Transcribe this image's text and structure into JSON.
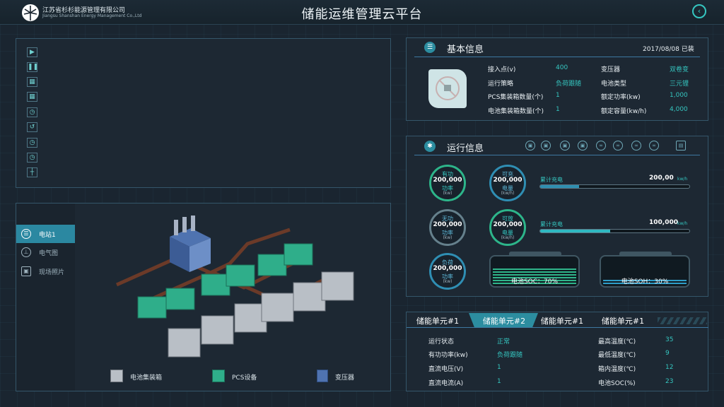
{
  "header": {
    "company_cn": "江苏省杉杉能源管理有限公司",
    "company_en": "Jiangsu Shanshan Energy Management Co.,Ltd",
    "title": "储能运维管理云平台",
    "back_icon": "back-arrow-icon"
  },
  "video_controls": [
    "play-icon",
    "pause-icon",
    "grid-4-icon",
    "grid-9-icon",
    "timer-icon",
    "history-icon",
    "clock-icon",
    "schedule-icon",
    "layout-icon"
  ],
  "station": {
    "sidebar": [
      {
        "label": "电站1",
        "icon": "station-icon",
        "active": true
      },
      {
        "label": "电气图",
        "icon": "circuit-icon",
        "active": false
      },
      {
        "label": "现场照片",
        "icon": "photo-icon",
        "active": false
      }
    ],
    "legend": [
      {
        "label": "电池集装箱",
        "icon": "battery-container-icon"
      },
      {
        "label": "PCS设备",
        "icon": "pcs-icon"
      },
      {
        "label": "变压器",
        "icon": "transformer-icon"
      }
    ]
  },
  "basic": {
    "title": "基本信息",
    "date": "2017/08/08 已装",
    "plug_icon": "plug-icon",
    "rows": [
      {
        "l1": "接入点(v)",
        "v1": "400",
        "l2": "变压器",
        "v2": "双卷变"
      },
      {
        "l1": "运行策略",
        "v1": "负荷跟随",
        "l2": "电池类型",
        "v2": "三元锂"
      },
      {
        "l1": "PCS集装箱数量(个)",
        "v1": "1",
        "l2": "额定功率(kw)",
        "v2": "1,000"
      },
      {
        "l1": "电池集装箱数量(个)",
        "v1": "1",
        "l2": "额定容量(kw/h)",
        "v2": "4,000"
      }
    ]
  },
  "runinfo": {
    "title": "运行信息",
    "tools": [
      "monitor-icon",
      "display-icon",
      "device-icon",
      "module-icon",
      "link-icon",
      "chain-icon",
      "connect-icon",
      "network-icon",
      "clipboard-icon"
    ],
    "gauges": [
      {
        "name": "有功",
        "value": "200,000",
        "sub": "功率",
        "unit": "(kw)",
        "style": "green"
      },
      {
        "name": "可充",
        "value": "200,000",
        "sub": "电量",
        "unit": "(kw/h)",
        "style": "blue"
      },
      {
        "name": "无功",
        "value": "200,000",
        "sub": "功率",
        "unit": "(kw)",
        "style": "gray"
      },
      {
        "name": "可放",
        "value": "200,000",
        "sub": "电量",
        "unit": "(kw/h)",
        "style": "green"
      },
      {
        "name": "负荷",
        "value": "200,000",
        "sub": "功率",
        "unit": "(kw)",
        "style": "blue"
      }
    ],
    "bars": [
      {
        "label": "累计充电",
        "value": "200,00",
        "unit": "kw/h",
        "fill": 0.26
      },
      {
        "label": "累计充电",
        "value": "100,000",
        "unit": "kw/h",
        "fill": 0.47
      }
    ],
    "soc": {
      "label": "电池SOC：70%",
      "level": 0.7
    },
    "soh": {
      "label": "电池SOH：30%",
      "level": 0.3
    }
  },
  "units": {
    "tabs": [
      "储能单元#1",
      "储能单元#2",
      "储能单元#1",
      "储能单元#1"
    ],
    "active_tab": 1,
    "rows": [
      {
        "l1": "运行状态",
        "v1": "正常",
        "l2": "最高温度(℃)",
        "v2": "35"
      },
      {
        "l1": "有功功率(kw)",
        "v1": "负荷跟随",
        "l2": "最低温度(℃)",
        "v2": "9"
      },
      {
        "l1": "直流电压(V)",
        "v1": "1",
        "l2": "箱内温度(℃)",
        "v2": "12"
      },
      {
        "l1": "直流电流(A)",
        "v1": "1",
        "l2": "电池SOC(%)",
        "v2": "23"
      }
    ]
  }
}
